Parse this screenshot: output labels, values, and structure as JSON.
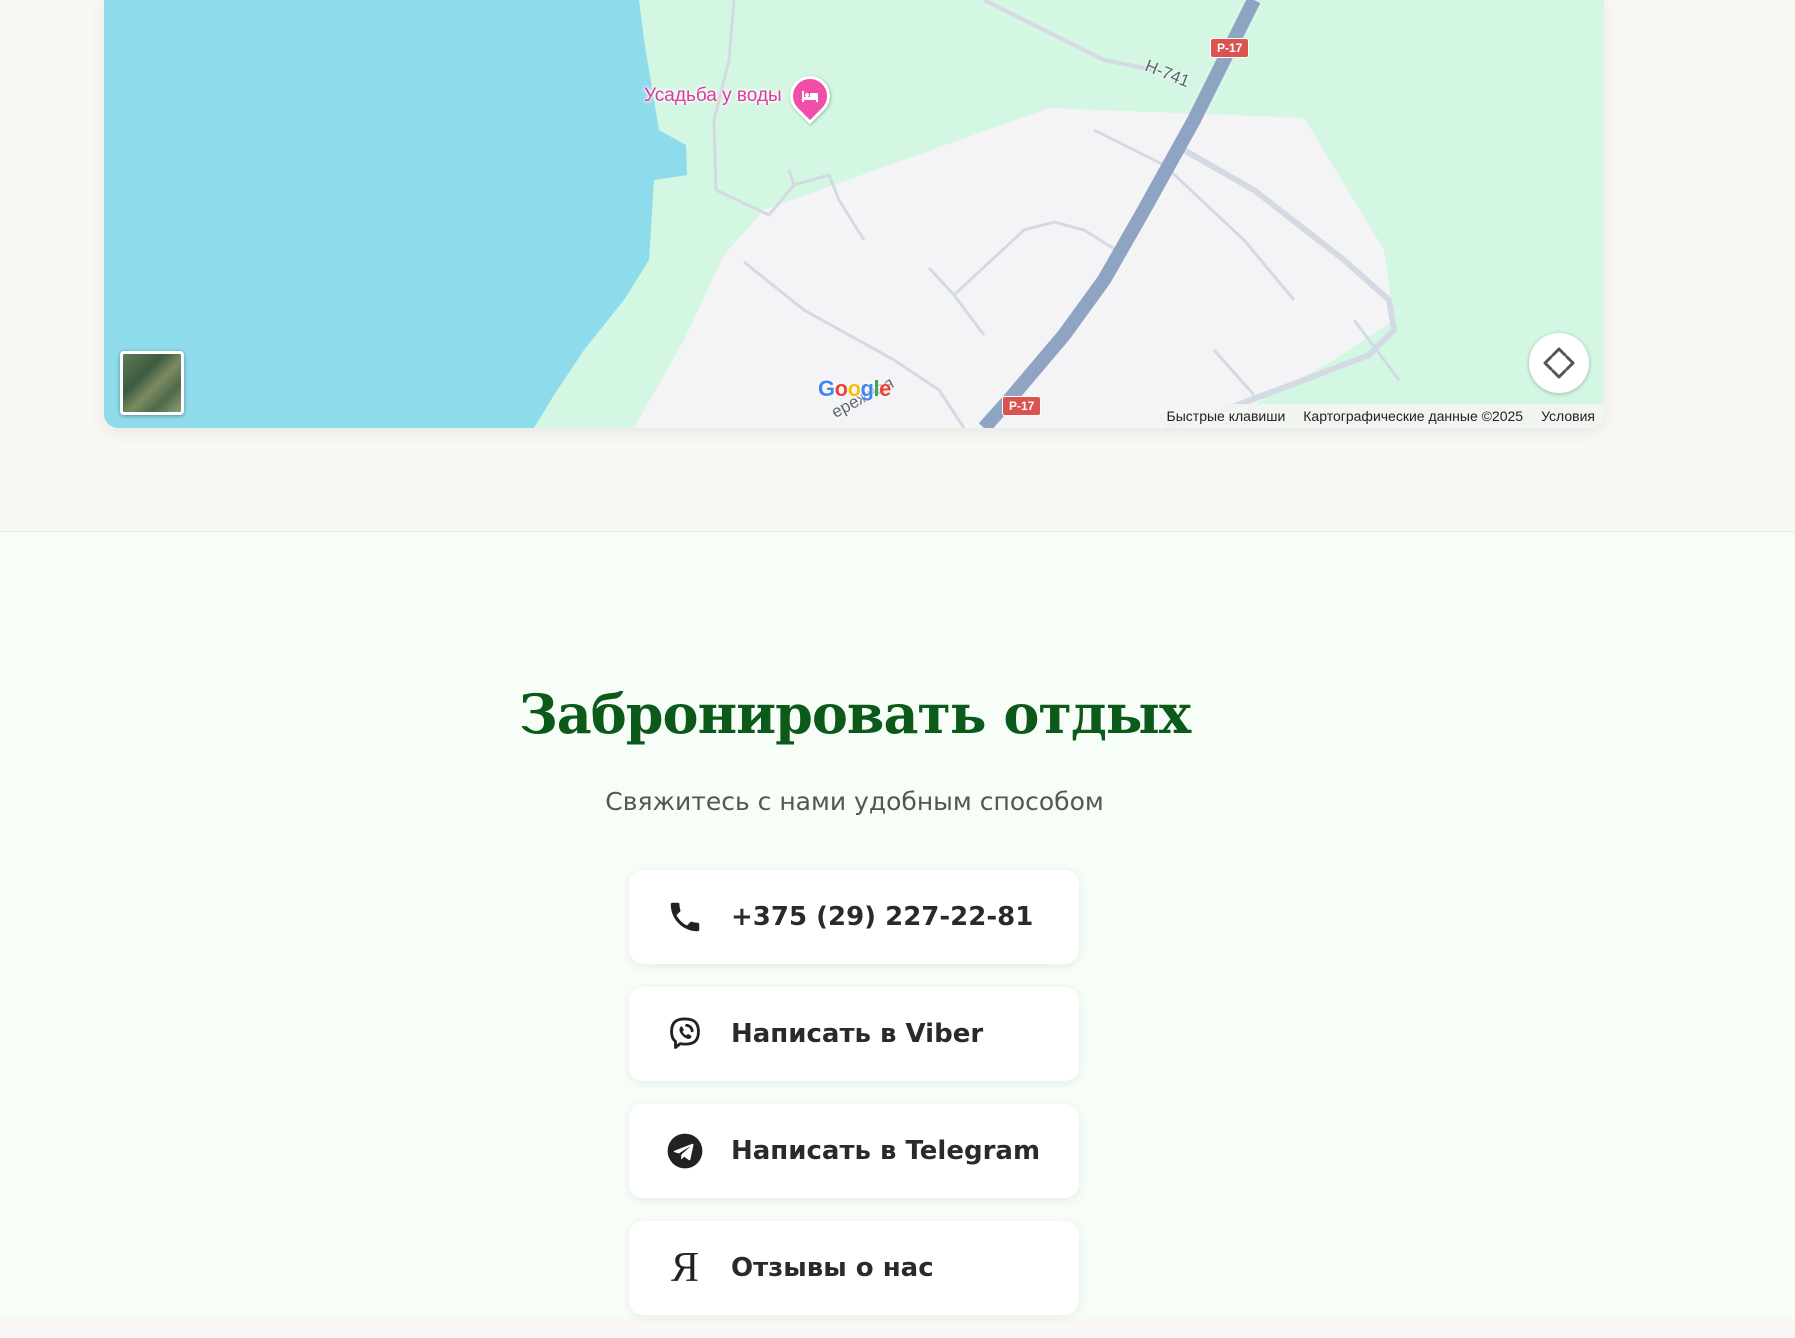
{
  "map": {
    "poi_label": "Усадьба у воды",
    "road_label": "Н-741",
    "street_label": "ережная",
    "shields": [
      "Р-17",
      "Р-17"
    ],
    "logo": "Google",
    "attribution": {
      "shortcuts": "Быстрые клавиши",
      "data": "Картографические данные ©2025",
      "terms": "Условия"
    }
  },
  "booking": {
    "title": "Забронировать отдых",
    "subtitle": "Свяжитесь с нами удобным способом",
    "buttons": [
      {
        "label": "+375 (29) 227-22-81",
        "icon": "phone-icon"
      },
      {
        "label": "Написать в Viber",
        "icon": "viber-icon"
      },
      {
        "label": "Написать в Telegram",
        "icon": "telegram-icon"
      },
      {
        "label": "Отзывы о нас",
        "icon": "yandex-icon",
        "glyph": "Я"
      }
    ]
  },
  "colors": {
    "water": "#8edbec",
    "park": "#d4f7e3",
    "land": "#f4f4f6",
    "highway": "#8fa4c3",
    "poi": "#e0389a",
    "title": "#0b5a1a"
  }
}
